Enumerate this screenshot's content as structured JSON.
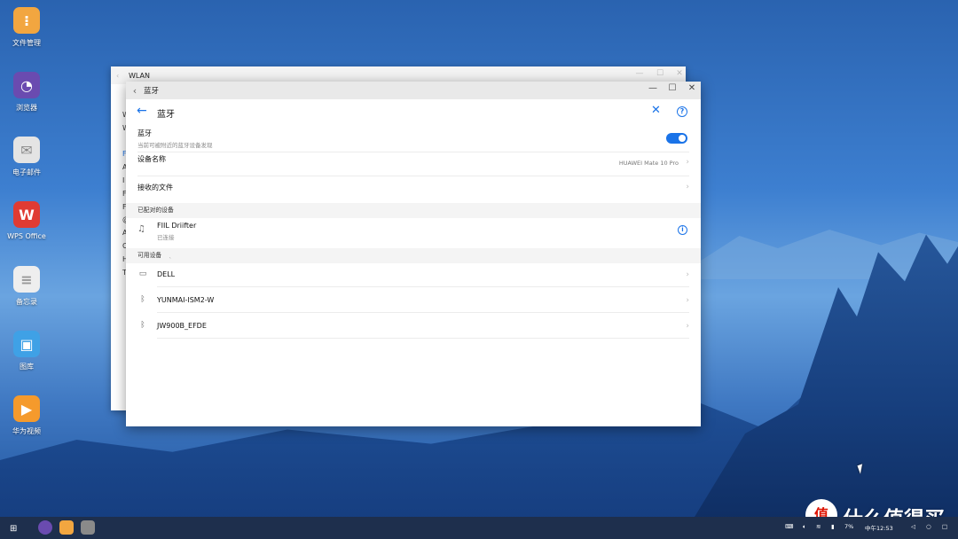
{
  "desktop": {
    "icons": [
      {
        "label": "文件管理",
        "color": "#f2a640",
        "glyph": "⁝"
      },
      {
        "label": "浏览器",
        "color": "#6a4bb0",
        "glyph": "◔"
      },
      {
        "label": "电子邮件",
        "color": "#e4e4e4",
        "glyph": "✉"
      },
      {
        "label": "WPS Office",
        "color": "#e03b33",
        "glyph": "W"
      },
      {
        "label": "备忘录",
        "color": "#eeeeee",
        "glyph": "≡"
      },
      {
        "label": "图库",
        "color": "#3fa1e6",
        "glyph": "▣"
      },
      {
        "label": "华为视频",
        "color": "#f59a2c",
        "glyph": "▶"
      }
    ]
  },
  "back_window": {
    "title": "WLAN",
    "letters": [
      "W",
      "W",
      "",
      "F",
      "A",
      "I",
      "F",
      "F",
      "@",
      "A",
      "C",
      "H",
      "T"
    ]
  },
  "bluetooth_window": {
    "titlebar_title": "蓝牙",
    "header_title": "蓝牙",
    "bluetooth_row": {
      "title": "蓝牙",
      "subtitle": "当前可被附近的蓝牙设备发现",
      "enabled": true
    },
    "device_name_row": {
      "title": "设备名称",
      "value": "HUAWEI Mate 10 Pro"
    },
    "received_files_row": {
      "title": "接收的文件"
    },
    "paired_section": "已配对的设备",
    "paired_devices": [
      {
        "name": "FIIL Driifter",
        "status": "已连接",
        "icon": "headphones-icon"
      }
    ],
    "available_section": "可用设备",
    "available_devices": [
      {
        "name": "DELL",
        "icon": "laptop-icon"
      },
      {
        "name": "YUNMAI-ISM2-W",
        "icon": "bluetooth-icon"
      },
      {
        "name": "JW900B_EFDE",
        "icon": "bluetooth-icon"
      }
    ]
  },
  "taskbar": {
    "battery": "7%",
    "time": "中午12:53"
  },
  "watermark": {
    "logo": "值",
    "text": "什么值得买"
  },
  "colors": {
    "accent": "#1a73e8",
    "taskbar": "#1e2f4d"
  }
}
